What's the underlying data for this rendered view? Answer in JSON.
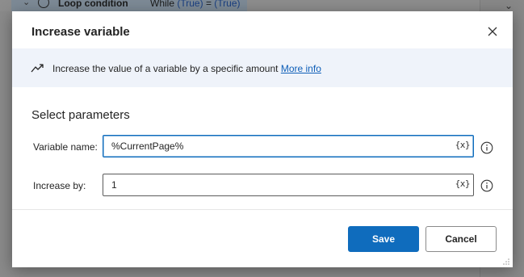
{
  "background": {
    "step_title": "Loop condition",
    "step_detail_prefix": "While",
    "step_detail_cond1": "(True)",
    "step_detail_eq": "=",
    "step_detail_cond2": "(True)"
  },
  "dialog": {
    "title": "Increase variable",
    "info": {
      "description": "Increase the value of a variable by a specific amount",
      "more_info_label": "More info"
    },
    "section_title": "Select parameters",
    "fields": {
      "variable_name": {
        "label": "Variable name:",
        "value": "%CurrentPage%",
        "var_button": "{x}"
      },
      "increase_by": {
        "label": "Increase by:",
        "value": "1",
        "var_button": "{x}"
      }
    },
    "buttons": {
      "save": "Save",
      "cancel": "Cancel"
    }
  },
  "colors": {
    "accent": "#0f6cbd",
    "info_banner_bg": "#eff3fa",
    "link": "#0f5fb8"
  }
}
